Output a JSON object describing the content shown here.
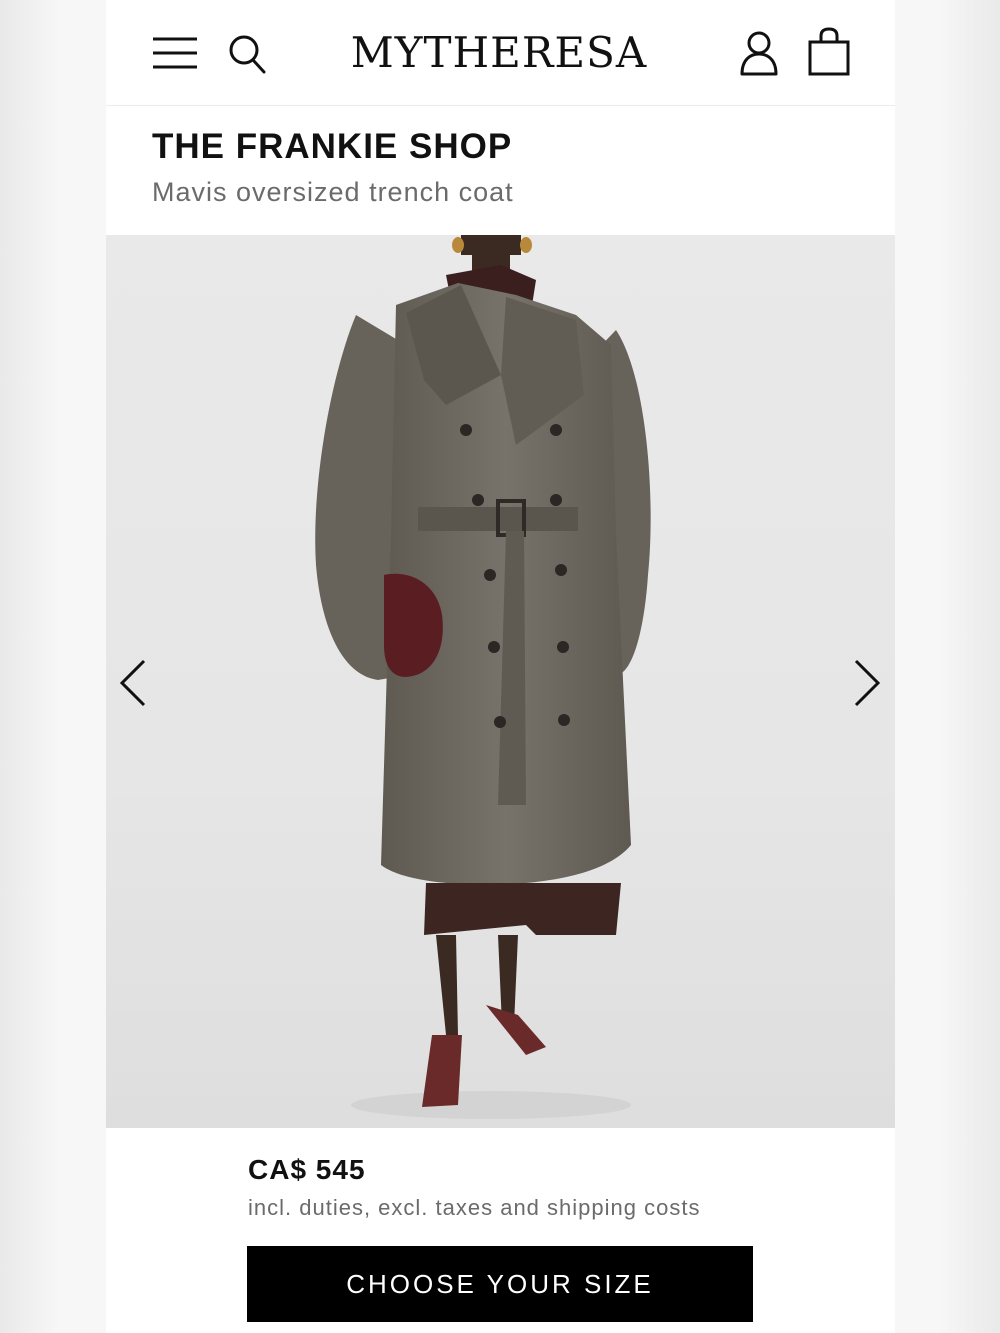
{
  "header": {
    "logo": "MYTHERESA",
    "icons": [
      "menu-icon",
      "search-icon",
      "account-icon",
      "shopping-bag-icon"
    ]
  },
  "product": {
    "brand": "THE FRANKIE SHOP",
    "name": "Mavis oversized trench coat",
    "price": "CA$ 545",
    "price_note": "incl. duties, excl. taxes and shipping costs",
    "cta_label": "CHOOSE YOUR SIZE"
  },
  "gallery": {
    "icons": [
      "chevron-left-icon",
      "chevron-right-icon"
    ]
  },
  "colors": {
    "text": "#111111",
    "muted": "#6b6b6b",
    "cta_bg": "#000000",
    "cta_text": "#ffffff",
    "coat": "#6f6a60",
    "bag": "#5a1e22"
  }
}
